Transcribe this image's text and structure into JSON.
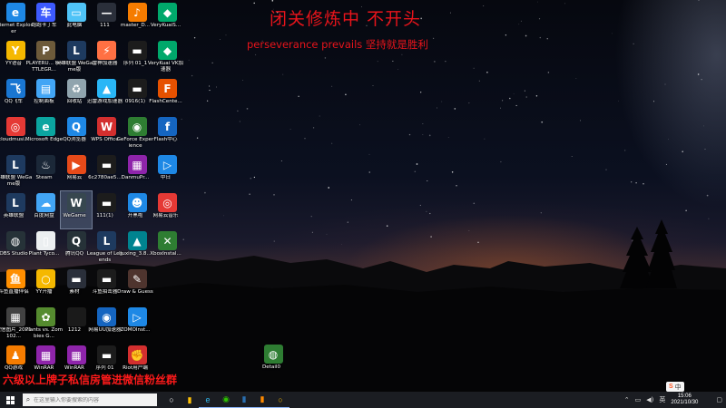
{
  "overlay": {
    "title": "闭关修炼中 不开头",
    "subtitle": "perseverance prevails  坚持就是胜利",
    "banner": "六级以上牌子私信房管进微信粉丝群"
  },
  "desktop_icons": [
    {
      "label": "Internet Explorer",
      "icon": "ie-icon",
      "color": "#1e88e5",
      "glyph": "e"
    },
    {
      "label": "跑跑卡丁车",
      "icon": "kart-icon",
      "color": "#3d5afe",
      "glyph": "车"
    },
    {
      "label": "此电脑",
      "icon": "this-pc-icon",
      "color": "#4fc3f7",
      "glyph": "▭"
    },
    {
      "label": "111",
      "icon": "folder-icon",
      "color": "#2a2f3a",
      "glyph": "—"
    },
    {
      "label": "master_D...",
      "icon": "master-icon",
      "color": "#f57c00",
      "glyph": "♪"
    },
    {
      "label": "VeryKuaiS...",
      "icon": "verykuai-icon",
      "color": "#00a86b",
      "glyph": "◆"
    },
    {
      "label": "YY语音",
      "icon": "yy-icon",
      "color": "#f5b800",
      "glyph": "Y"
    },
    {
      "label": "PLAYERU... BATTLEGR...",
      "icon": "pubg-icon",
      "color": "#6d5a3a",
      "glyph": "P"
    },
    {
      "label": "英雄联盟 WeGame版",
      "icon": "lol-icon",
      "color": "#1e3a5f",
      "glyph": "L"
    },
    {
      "label": "雷神加速器",
      "icon": "leishen-icon",
      "color": "#ff7043",
      "glyph": "⚡"
    },
    {
      "label": "序列 01_1",
      "icon": "video-icon",
      "color": "#1c1c1c",
      "glyph": "▬"
    },
    {
      "label": "VeryKuai VK加速器",
      "icon": "verykuai-vk-icon",
      "color": "#00a86b",
      "glyph": "◆"
    },
    {
      "label": "QQ飞车",
      "icon": "qqspeed-icon",
      "color": "#1976d2",
      "glyph": "飞"
    },
    {
      "label": "控制面板",
      "icon": "control-panel-icon",
      "color": "#42a5f5",
      "glyph": "▤"
    },
    {
      "label": "回收站",
      "icon": "recycle-bin-icon",
      "color": "#90a4ae",
      "glyph": "♻"
    },
    {
      "label": "迅雷游戏加速器",
      "icon": "xunlei-icon",
      "color": "#29b6f6",
      "glyph": "▲"
    },
    {
      "label": "0916(1)",
      "icon": "video-icon",
      "color": "#1c1c1c",
      "glyph": "▬"
    },
    {
      "label": "FlashCente...",
      "icon": "flash-center-icon",
      "color": "#e65100",
      "glyph": "F"
    },
    {
      "label": "cloudmusi...",
      "icon": "cloudmusic-icon",
      "color": "#e53935",
      "glyph": "◎"
    },
    {
      "label": "Microsoft Edge",
      "icon": "edge-icon",
      "color": "#0ba5a0",
      "glyph": "e"
    },
    {
      "label": "QQ浏览器",
      "icon": "qqbrowser-icon",
      "color": "#1e88e5",
      "glyph": "Q"
    },
    {
      "label": "WPS Office",
      "icon": "wps-icon",
      "color": "#d32f2f",
      "glyph": "W"
    },
    {
      "label": "GeForce Experience",
      "icon": "geforce-icon",
      "color": "#2e7d32",
      "glyph": "◉"
    },
    {
      "label": "Flash中心",
      "icon": "flash-icon",
      "color": "#1565c0",
      "glyph": "f"
    },
    {
      "label": "英雄联盟 WeGame版",
      "icon": "lol-icon",
      "color": "#1e3a5f",
      "glyph": "L"
    },
    {
      "label": "Steam",
      "icon": "steam-icon",
      "color": "#1b2838",
      "glyph": "♨"
    },
    {
      "label": "网易云",
      "icon": "netease-icon",
      "color": "#e64a19",
      "glyph": "▶"
    },
    {
      "label": "6c2780ae5...",
      "icon": "video-icon",
      "color": "#1c1c1c",
      "glyph": "▬"
    },
    {
      "label": "DanmuPr...",
      "icon": "winrar-icon",
      "color": "#8e24aa",
      "glyph": "▦"
    },
    {
      "label": "中日",
      "icon": "zhongri-icon",
      "color": "#1e88e5",
      "glyph": "▷"
    },
    {
      "label": "英雄联盟",
      "icon": "lol-icon",
      "color": "#1e3a5f",
      "glyph": "L"
    },
    {
      "label": "百度网盘",
      "icon": "baidu-netdisk-icon",
      "color": "#42a5f5",
      "glyph": "☁"
    },
    {
      "label": "WeGame",
      "icon": "wegame-icon",
      "color": "#37474f",
      "glyph": "W"
    },
    {
      "label": "111(1)",
      "icon": "video-icon",
      "color": "#1c1c1c",
      "glyph": "▬"
    },
    {
      "label": "开黑啦",
      "icon": "kaiheila-icon",
      "color": "#1e88e5",
      "glyph": "☻"
    },
    {
      "label": "网易云音乐",
      "icon": "cloudmusic-icon",
      "color": "#e53935",
      "glyph": "◎"
    },
    {
      "label": "OBS Studio",
      "icon": "obs-icon",
      "color": "#263238",
      "glyph": "◍"
    },
    {
      "label": "Plant Tyco...",
      "icon": "document-icon",
      "color": "#eceff1",
      "glyph": "▯"
    },
    {
      "label": "腾讯QQ",
      "icon": "qq-icon",
      "color": "#263238",
      "glyph": "Q"
    },
    {
      "label": "League of Legends",
      "icon": "lol-icon",
      "color": "#1e3a5f",
      "glyph": "L"
    },
    {
      "label": "liuxing_3.8...",
      "icon": "liuxing-icon",
      "color": "#00838f",
      "glyph": "▲"
    },
    {
      "label": "XboxInstal...",
      "icon": "xbox-icon",
      "color": "#2e7d32",
      "glyph": "✕"
    },
    {
      "label": "斗鱼直播伴侣",
      "icon": "douyu-icon",
      "color": "#ff8f00",
      "glyph": "鱼"
    },
    {
      "label": "YY开播",
      "icon": "yy-live-icon",
      "color": "#f5b800",
      "glyph": "○"
    },
    {
      "label": "素材",
      "icon": "folder-icon",
      "color": "#2a2f3a",
      "glyph": "▬"
    },
    {
      "label": "斗鱼拍击器",
      "icon": "video-icon",
      "color": "#1c1c1c",
      "glyph": "▬"
    },
    {
      "label": "Draw & Guess",
      "icon": "draw-guess-icon",
      "color": "#4e342e",
      "glyph": "✎"
    },
    {
      "label": "微信图片_2021102...",
      "icon": "image-icon",
      "color": "#424242",
      "glyph": "▦"
    },
    {
      "label": "Plants vs. Zombies G...",
      "icon": "pvz-icon",
      "color": "#558b2f",
      "glyph": "✿"
    },
    {
      "label": "1212",
      "icon": "blank-file-icon",
      "color": "#1a1a1a",
      "glyph": ""
    },
    {
      "label": "网易UU加速器",
      "icon": "uu-icon",
      "color": "#1565c0",
      "glyph": "◉"
    },
    {
      "label": "ZOMOInst...",
      "icon": "zomo-icon",
      "color": "#1e88e5",
      "glyph": "▷"
    },
    {
      "label": "QQ游戏",
      "icon": "qqgame-icon",
      "color": "#f57c00",
      "glyph": "♟"
    },
    {
      "label": "WinRAR",
      "icon": "winrar-icon",
      "color": "#8e24aa",
      "glyph": "▦"
    },
    {
      "label": "WinRAR",
      "icon": "winrar-icon",
      "color": "#8e24aa",
      "glyph": "▦"
    },
    {
      "label": "序列 01",
      "icon": "video-icon",
      "color": "#1c1c1c",
      "glyph": "▬"
    },
    {
      "label": "Riot用户端",
      "icon": "riot-icon",
      "color": "#d32f2f",
      "glyph": "✊"
    },
    {
      "label": "Detail0",
      "icon": "globe-icon",
      "color": "#2e7d32",
      "glyph": "◍"
    }
  ],
  "taskbar": {
    "search_placeholder": "在这里输入你要搜索的内容",
    "apps": [
      {
        "icon": "task-view-icon",
        "glyph": "○",
        "color": "#ffffff"
      },
      {
        "icon": "file-explorer-icon",
        "glyph": "▮",
        "color": "#ffc107"
      },
      {
        "icon": "edge-icon",
        "glyph": "e",
        "color": "#2fb4e9"
      },
      {
        "icon": "wechat-icon",
        "glyph": "◉",
        "color": "#2dc100"
      },
      {
        "icon": "cortana-icon",
        "glyph": "▮",
        "color": "#2a6fb0"
      },
      {
        "icon": "sogou-app-icon",
        "glyph": "▮",
        "color": "#ff8a00"
      },
      {
        "icon": "yy-live-icon",
        "glyph": "○",
        "color": "#f5b800"
      }
    ],
    "ime_label": "中",
    "tray_input": "英",
    "time": "15:06",
    "date": "2021/10/30"
  }
}
